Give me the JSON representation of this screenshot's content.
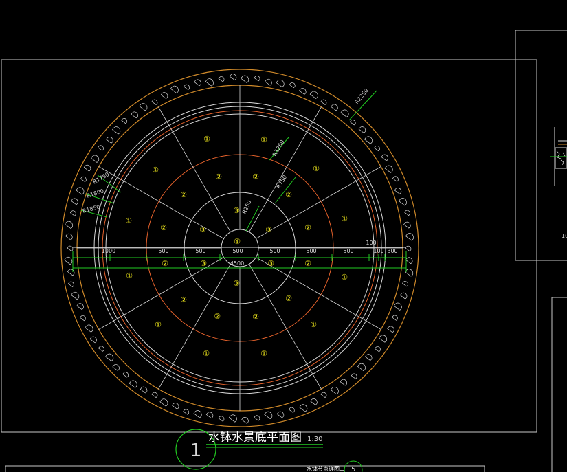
{
  "drawing": {
    "title": "水钵水景底平面图",
    "scale": "1:30",
    "callout_number": "1",
    "sub_title": "水钵节点详图二",
    "sub_callout_number": "5",
    "side_label": "10",
    "colors": {
      "background": "#000000",
      "frame": "#c8c8c8",
      "circle_white": "#d8d8d8",
      "circle_orange": "#e8632c",
      "rim_orange": "#d08a2a",
      "dimension_green": "#22cc22",
      "zone_marker_yellow": "#f2ea1c",
      "title_white": "#ffffff"
    }
  },
  "radius_labels": {
    "outer": "R2250",
    "r1250": "R1250",
    "r750": "R750",
    "r250": "R250",
    "r1750": "R1750",
    "r1800": "R1800",
    "r1850": "R1850"
  },
  "dimensions": {
    "top_row": [
      "1000",
      "500",
      "500",
      "500",
      "500",
      "500",
      "500",
      "100",
      "100",
      "300"
    ],
    "total": "4500",
    "bottom_row_zones": [
      "②",
      "③",
      "③",
      "②"
    ]
  },
  "zones": {
    "center": "④",
    "ring3": [
      "③",
      "③",
      "③",
      "③"
    ],
    "ring2": [
      "②",
      "②",
      "②",
      "②",
      "②",
      "②",
      "②",
      "②"
    ],
    "ring1": [
      "①",
      "①",
      "①",
      "①",
      "①",
      "①",
      "①",
      "①",
      "①",
      "①",
      "①",
      "①",
      "①",
      "①",
      "①"
    ]
  }
}
